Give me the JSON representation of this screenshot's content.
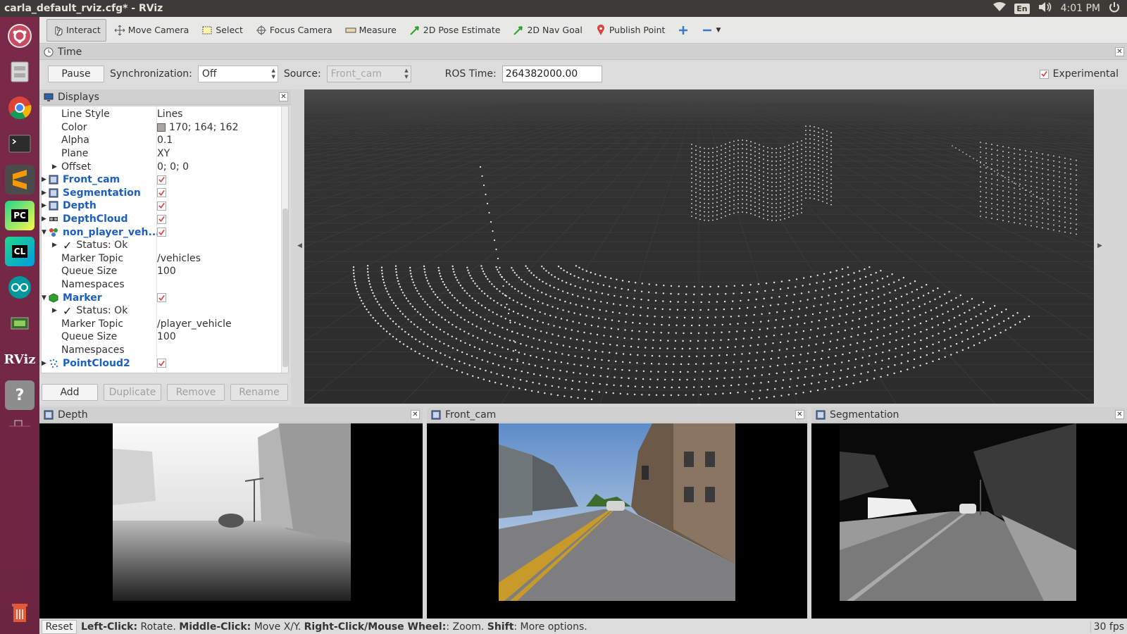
{
  "window": {
    "title": "carla_default_rviz.cfg* - RViz"
  },
  "system_tray": {
    "language": "En",
    "time": "4:01 PM"
  },
  "launcher": {
    "items": [
      "ubuntu-dash",
      "files",
      "chrome",
      "terminal",
      "sublime-text",
      "pycharm",
      "clion",
      "arduino",
      "system-monitor",
      "rviz",
      "help"
    ],
    "pycharm_label": "PC",
    "clion_label": "CL",
    "rviz_label": "RViz"
  },
  "toolbar": {
    "interact": "Interact",
    "move_camera": "Move Camera",
    "select": "Select",
    "focus_camera": "Focus Camera",
    "measure": "Measure",
    "pose_estimate": "2D Pose Estimate",
    "nav_goal": "2D Nav Goal",
    "publish_point": "Publish Point"
  },
  "time_panel": {
    "title": "Time",
    "pause_label": "Pause",
    "sync_label": "Synchronization:",
    "sync_value": "Off",
    "source_label": "Source:",
    "source_value": "Front_cam",
    "ros_time_label": "ROS Time:",
    "ros_time_value": "264382000.00",
    "experimental_label": "Experimental",
    "experimental_checked": true
  },
  "displays": {
    "title": "Displays",
    "rows": [
      {
        "key": "Line Style",
        "value": "Lines"
      },
      {
        "key": "Color",
        "value": "170; 164; 162"
      },
      {
        "key": "Alpha",
        "value": "0.1"
      },
      {
        "key": "Plane",
        "value": "XY"
      },
      {
        "key": "Offset",
        "value": "0; 0; 0"
      },
      {
        "key": "Front_cam",
        "checked": true
      },
      {
        "key": "Segmentation",
        "checked": true
      },
      {
        "key": "Depth",
        "checked": true
      },
      {
        "key": "DepthCloud",
        "checked": true
      },
      {
        "key": "non_player_veh...",
        "checked": true
      },
      {
        "key": "Status: Ok"
      },
      {
        "key": "Marker Topic",
        "value": "/vehicles"
      },
      {
        "key": "Queue Size",
        "value": "100"
      },
      {
        "key": "Namespaces",
        "value": ""
      },
      {
        "key": "Marker",
        "checked": true
      },
      {
        "key": "Status: Ok"
      },
      {
        "key": "Marker Topic",
        "value": "/player_vehicle"
      },
      {
        "key": "Queue Size",
        "value": "100"
      },
      {
        "key": "Namespaces",
        "value": ""
      },
      {
        "key": "PointCloud2",
        "checked": true
      }
    ],
    "buttons": {
      "add": "Add",
      "duplicate": "Duplicate",
      "remove": "Remove",
      "rename": "Rename"
    }
  },
  "image_panels": {
    "depth": "Depth",
    "front_cam": "Front_cam",
    "segmentation": "Segmentation"
  },
  "status_bar": {
    "reset": "Reset",
    "hint_left_click": "Left-Click:",
    "hint_rotate": " Rotate. ",
    "hint_middle_click": "Middle-Click:",
    "hint_move": " Move X/Y. ",
    "hint_right_click": "Right-Click/Mouse Wheel:",
    "hint_zoom": ": Zoom. ",
    "hint_shift": "Shift",
    "hint_more": ": More options.",
    "fps": "30 fps"
  },
  "colors": {
    "blue_item": "#1c5fbf",
    "check_red": "#d9453e",
    "launcher": "#74284a",
    "viewport_bg": "#2e2e2e"
  }
}
